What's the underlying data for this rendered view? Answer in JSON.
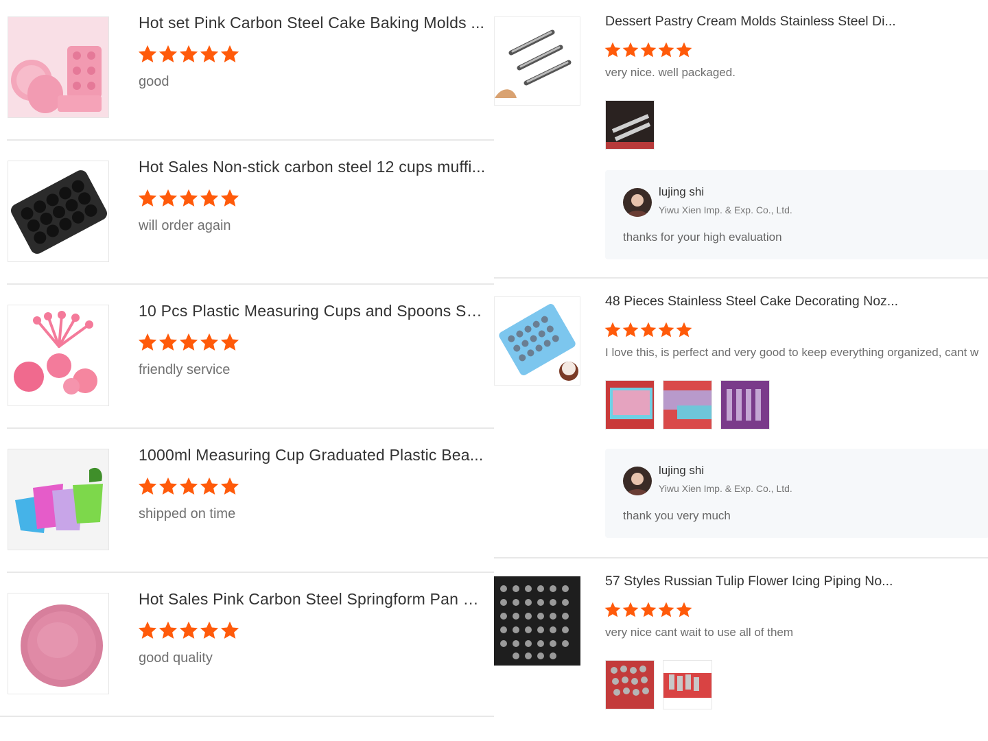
{
  "colors": {
    "star": "#ff5a0a",
    "separator": "#e8e8e8"
  },
  "left_reviews": [
    {
      "title": "Hot set Pink Carbon Steel Cake Baking Molds ...",
      "rating": 5,
      "review": "good",
      "thumb": "pink-baking-molds-set"
    },
    {
      "title": "Hot Sales Non-stick carbon steel 12 cups muffi...",
      "rating": 5,
      "review": "will order again",
      "thumb": "black-muffin-tray"
    },
    {
      "title": "10 Pcs Plastic Measuring Cups and Spoons Se...",
      "rating": 5,
      "review": "friendly service",
      "thumb": "pink-measuring-cups"
    },
    {
      "title": "1000ml Measuring Cup Graduated Plastic Bea...",
      "rating": 5,
      "review": "shipped on time",
      "thumb": "colorful-measuring-cups"
    },
    {
      "title": "Hot Sales Pink Carbon Steel Springform Pan S...",
      "rating": 5,
      "review": "good quality",
      "thumb": "pink-springform-pan"
    }
  ],
  "right_reviews": [
    {
      "title": "Dessert Pastry Cream Molds Stainless Steel Di...",
      "rating": 5,
      "review": "very nice. well packaged.",
      "photos": 1,
      "reply": {
        "name": "lujing shi",
        "company": "Yiwu Xien Imp. & Exp. Co., Ltd.",
        "text": "thanks for your high evaluation"
      }
    },
    {
      "title": "48 Pieces Stainless Steel Cake Decorating Noz...",
      "rating": 5,
      "review": "I love this, is perfect and very good to keep everything organized, cant w",
      "photos": 3,
      "reply": {
        "name": "lujing shi",
        "company": "Yiwu Xien Imp. & Exp. Co., Ltd.",
        "text": "thank you very much"
      }
    },
    {
      "title": "57 Styles Russian Tulip Flower Icing Piping No...",
      "rating": 5,
      "review": "very nice cant wait to use all of them",
      "photos": 2
    }
  ]
}
